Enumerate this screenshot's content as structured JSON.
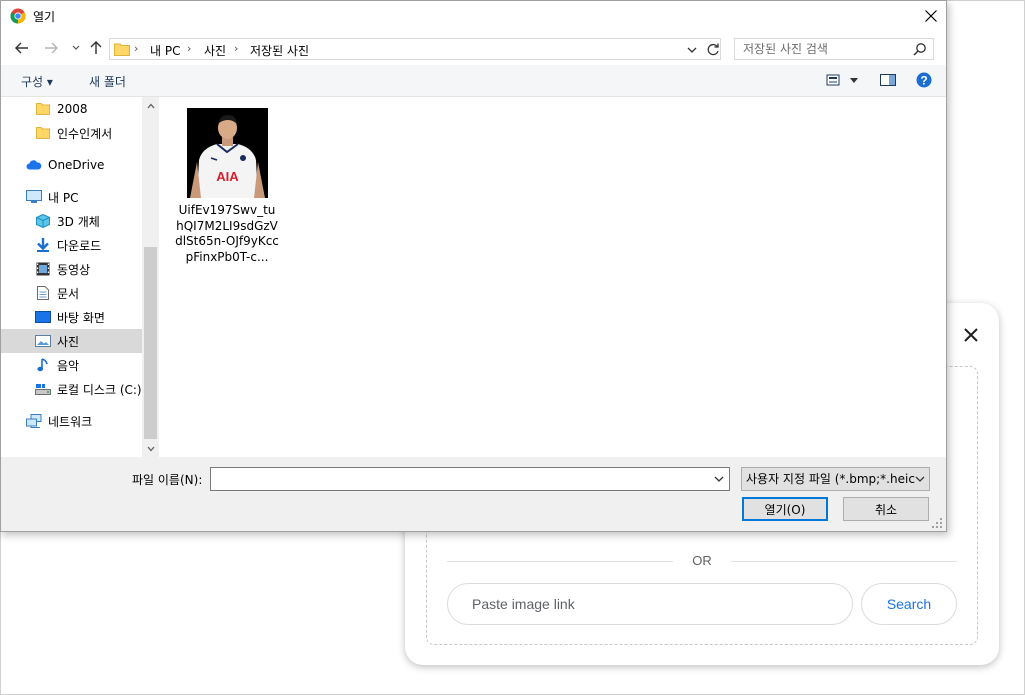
{
  "dialog": {
    "title": "열기",
    "breadcrumb": [
      "내 PC",
      "사진",
      "저장된 사진"
    ],
    "search_placeholder": "저장된 사진 검색",
    "toolbar": {
      "organize": "구성 ▾",
      "new_folder": "새 폴더"
    },
    "nav_tree": [
      {
        "label": "2008",
        "icon": "folder-icon"
      },
      {
        "label": "인수인계서",
        "icon": "folder-icon"
      },
      {
        "label": "OneDrive",
        "icon": "cloud-icon"
      },
      {
        "label": "내 PC",
        "icon": "computer-icon"
      },
      {
        "label": "3D 개체",
        "icon": "cube-icon"
      },
      {
        "label": "다운로드",
        "icon": "download-icon"
      },
      {
        "label": "동영상",
        "icon": "video-icon"
      },
      {
        "label": "문서",
        "icon": "document-icon"
      },
      {
        "label": "바탕 화면",
        "icon": "desktop-icon"
      },
      {
        "label": "사진",
        "icon": "pictures-icon",
        "selected": true
      },
      {
        "label": "음악",
        "icon": "music-icon"
      },
      {
        "label": "로컬 디스크 (C:)",
        "icon": "drive-icon"
      },
      {
        "label": "네트워크",
        "icon": "network-icon"
      }
    ],
    "files": [
      {
        "name": "UifEv197Swv_tuhQI7M2LI9sdGzVdlSt65n-OJf9yKccpFinxPb0T-c..."
      }
    ],
    "thumb_text": "AIA",
    "filename_label": "파일 이름(N):",
    "filename_value": "",
    "filter_label": "사용자 지정 파일 (*.bmp;*.heic",
    "open_button": "열기(O)",
    "cancel_button": "취소"
  },
  "lens": {
    "or_text": "OR",
    "link_placeholder": "Paste image link",
    "search_button": "Search"
  },
  "colors": {
    "accent": "#0078d7",
    "link_blue": "#1a73e8",
    "selection": "#d9d9d9"
  }
}
